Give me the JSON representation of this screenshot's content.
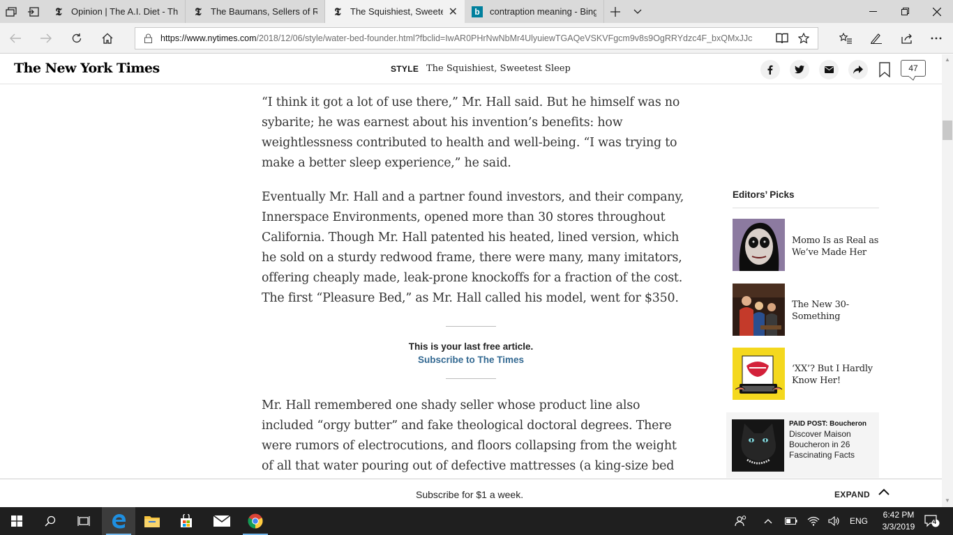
{
  "browser": {
    "tabs": [
      {
        "title": "Opinion | The A.I. Diet - The",
        "favicon": "nyt-icon"
      },
      {
        "title": "The Baumans, Sellers of Rea",
        "favicon": "nyt-icon"
      },
      {
        "title": "The Squishiest, Sweetes",
        "favicon": "nyt-icon",
        "active": true
      },
      {
        "title": "contraption meaning - Bing",
        "favicon": "bing-icon"
      }
    ],
    "url_domain": "https://www.nytimes.com",
    "url_path": "/2018/12/06/style/water-bed-founder.html?fbclid=IwAR0PHrNwNbMr4UlyuiewTGAQeVSKVFgcm9v8s9OgRRYdzc4F_bxQMxJJc"
  },
  "header": {
    "logo": "The New York Times",
    "section": "STYLE",
    "title": "The Squishiest, Sweetest Sleep",
    "comment_count": "47"
  },
  "article": {
    "paragraphs": [
      "“I think it got a lot of use there,” Mr. Hall said. But he himself was no sybarite; he was earnest about his invention’s benefits: how weightlessness contributed to health and well-being. “I was trying to make a better sleep experience,” he said.",
      "Eventually Mr. Hall and a partner found investors, and their company, Innerspace Environments, opened more than 30 stores throughout California. Though Mr. Hall patented his heated, lined version, which he sold on a sturdy redwood frame, there were many, many imitators, offering cheaply made, leak-prone knockoffs for a fraction of the cost. The first “Pleasure Bed,” as Mr. Hall called his model, went for $350.",
      "Mr. Hall remembered one shady seller whose product line also included “orgy butter” and fake theological doctoral degrees. There were rumors of electrocutions, and floors collapsing from the weight of all that water pouring out of defective mattresses (a king-size bed"
    ],
    "gate_message": "This is your last free article.",
    "gate_link": "Subscribe to The Times"
  },
  "sidebar": {
    "heading": "Editors’ Picks",
    "picks": [
      {
        "title": "Momo Is as Real as We’ve Made Her"
      },
      {
        "title": "The New 30-Something"
      },
      {
        "title": "‘XX’? But I Hardly Know Her!"
      }
    ],
    "paid_label": "PAID POST: Boucheron",
    "paid_title": "Discover Maison Boucheron in 26 Fascinating Facts"
  },
  "subscribe_bar": {
    "text": "Subscribe for $1 a week.",
    "expand": "EXPAND"
  },
  "taskbar": {
    "language": "ENG",
    "time": "6:42 PM",
    "date": "3/3/2019",
    "notification_count": "4"
  },
  "colors": {
    "link": "#326891",
    "taskbar": "#1f1f1f",
    "tab_bar": "#dadada"
  }
}
